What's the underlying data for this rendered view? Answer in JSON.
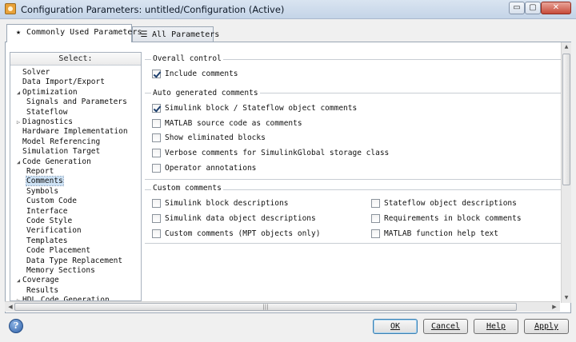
{
  "window": {
    "title": "Configuration Parameters: untitled/Configuration (Active)",
    "controls": {
      "minimize": "▭",
      "maximize": "▢",
      "close": "✕"
    }
  },
  "tabs": [
    {
      "label": "Commonly Used Parameters",
      "icon": "star-icon",
      "glyph": "★",
      "active": true
    },
    {
      "label": "All Parameters",
      "icon": "list-icon",
      "glyph": "☰",
      "active": false
    }
  ],
  "tree": {
    "header": "Select:",
    "items": [
      {
        "label": "Solver",
        "level": 0,
        "expander": ""
      },
      {
        "label": "Data Import/Export",
        "level": 0,
        "expander": ""
      },
      {
        "label": "Optimization",
        "level": 0,
        "expander": "◢"
      },
      {
        "label": "Signals and Parameters",
        "level": 1,
        "expander": ""
      },
      {
        "label": "Stateflow",
        "level": 1,
        "expander": ""
      },
      {
        "label": "Diagnostics",
        "level": 0,
        "expander": "▷"
      },
      {
        "label": "Hardware Implementation",
        "level": 0,
        "expander": ""
      },
      {
        "label": "Model Referencing",
        "level": 0,
        "expander": ""
      },
      {
        "label": "Simulation Target",
        "level": 0,
        "expander": ""
      },
      {
        "label": "Code Generation",
        "level": 0,
        "expander": "◢"
      },
      {
        "label": "Report",
        "level": 1,
        "expander": ""
      },
      {
        "label": "Comments",
        "level": 1,
        "expander": "",
        "selected": true
      },
      {
        "label": "Symbols",
        "level": 1,
        "expander": ""
      },
      {
        "label": "Custom Code",
        "level": 1,
        "expander": ""
      },
      {
        "label": "Interface",
        "level": 1,
        "expander": ""
      },
      {
        "label": "Code Style",
        "level": 1,
        "expander": ""
      },
      {
        "label": "Verification",
        "level": 1,
        "expander": ""
      },
      {
        "label": "Templates",
        "level": 1,
        "expander": ""
      },
      {
        "label": "Code Placement",
        "level": 1,
        "expander": ""
      },
      {
        "label": "Data Type Replacement",
        "level": 1,
        "expander": ""
      },
      {
        "label": "Memory Sections",
        "level": 1,
        "expander": ""
      },
      {
        "label": "Coverage",
        "level": 0,
        "expander": "◢"
      },
      {
        "label": "Results",
        "level": 1,
        "expander": ""
      },
      {
        "label": "HDL Code Generation",
        "level": 0,
        "expander": "▷"
      }
    ]
  },
  "groups": {
    "overall": {
      "title": "Overall control",
      "options": [
        {
          "label": "Include comments",
          "checked": true
        }
      ]
    },
    "auto": {
      "title": "Auto generated comments",
      "options": [
        {
          "label": "Simulink block / Stateflow object comments",
          "checked": true
        },
        {
          "label": "MATLAB source code as comments",
          "checked": false
        },
        {
          "label": "Show eliminated blocks",
          "checked": false
        },
        {
          "label": "Verbose comments for SimulinkGlobal storage class",
          "checked": false
        },
        {
          "label": "Operator annotations",
          "checked": false
        }
      ]
    },
    "custom": {
      "title": "Custom comments",
      "left": [
        {
          "label": "Simulink block descriptions",
          "checked": false
        },
        {
          "label": "Simulink data object descriptions",
          "checked": false
        },
        {
          "label": "Custom comments (MPT objects only)",
          "checked": false
        }
      ],
      "right": [
        {
          "label": "Stateflow object descriptions",
          "checked": false
        },
        {
          "label": "Requirements in block comments",
          "checked": false
        },
        {
          "label": "MATLAB function help text",
          "checked": false
        }
      ]
    }
  },
  "scrollbars": {
    "up": "▲",
    "down": "▼",
    "left": "◀",
    "right": "▶",
    "grip": "|||"
  },
  "buttons": {
    "help_glyph": "?",
    "ok": "OK",
    "cancel": "Cancel",
    "help": "Help",
    "apply": "Apply"
  }
}
